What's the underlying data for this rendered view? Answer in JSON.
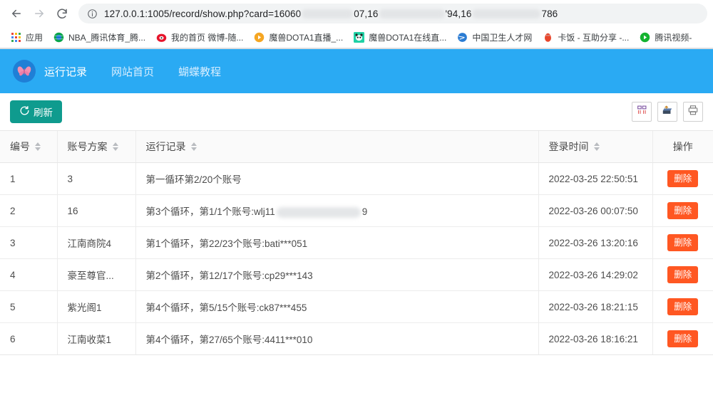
{
  "browser": {
    "back_icon": "back-arrow-icon",
    "forward_icon": "forward-arrow-icon",
    "reload_icon": "reload-icon",
    "info_icon": "site-info-icon",
    "url_prefix": "127.0.0.1:1005/record/show.php?card=16060",
    "url_part2": "07,16",
    "url_part3": "'94,16",
    "url_part4": "786",
    "bookmarks": [
      {
        "label": "应用",
        "icon": "apps-grid-icon",
        "color": "#4285f4"
      },
      {
        "label": "NBA_腾讯体育_腾...",
        "icon": "tencent-sports-icon",
        "color": "#0aa54a"
      },
      {
        "label": "我的首页 微博-随...",
        "icon": "weibo-icon",
        "color": "#e6162d"
      },
      {
        "label": "魔兽DOTA1直播_...",
        "icon": "live-play-icon",
        "color": "#f5a623"
      },
      {
        "label": "魔兽DOTA1在线直...",
        "icon": "panda-tv-icon",
        "color": "#1fd1a5"
      },
      {
        "label": "中国卫生人才网",
        "icon": "globe-icon",
        "color": "#2b7cd3"
      },
      {
        "label": "卡饭 - 互助分享 -...",
        "icon": "qq-penguin-icon",
        "color": "#e8462c"
      },
      {
        "label": "腾讯视频-",
        "icon": "tencent-video-icon",
        "color": "#14b330"
      }
    ]
  },
  "site": {
    "logo_icon": "butterfly-logo-icon",
    "nav": [
      {
        "label": "运行记录",
        "active": true
      },
      {
        "label": "网站首页",
        "active": false
      },
      {
        "label": "蝴蝶教程",
        "active": false
      }
    ]
  },
  "toolbar": {
    "refresh_label": "刷新",
    "refresh_icon": "refresh-icon",
    "columns_icon": "columns-toggle-icon",
    "export_icon": "export-icon",
    "print_icon": "print-icon",
    "refresh_color": "#0f9b8e"
  },
  "table": {
    "columns": [
      {
        "label": "编号",
        "sortable": true
      },
      {
        "label": "账号方案",
        "sortable": true
      },
      {
        "label": "运行记录",
        "sortable": true
      },
      {
        "label": "登录时间",
        "sortable": true
      },
      {
        "label": "操作",
        "sortable": false
      }
    ],
    "delete_label": "删除",
    "delete_color": "#ff5722",
    "rows": [
      {
        "id": "1",
        "plan": "3",
        "record_pre": "第一循环第2/20个账号",
        "record_post": "",
        "redacted": false,
        "time": "2022-03-25 22:50:51"
      },
      {
        "id": "2",
        "plan": "16",
        "record_pre": "第3个循环，第1/1个账号:wlj11",
        "record_post": "9",
        "redacted": true,
        "time": "2022-03-26 00:07:50"
      },
      {
        "id": "3",
        "plan": "江南商院4",
        "record_pre": "第1个循环，第22/23个账号:bati***051",
        "record_post": "",
        "redacted": false,
        "time": "2022-03-26 13:20:16"
      },
      {
        "id": "4",
        "plan": "豪至尊官...",
        "record_pre": "第2个循环，第12/17个账号:cp29***143",
        "record_post": "",
        "redacted": false,
        "time": "2022-03-26 14:29:02"
      },
      {
        "id": "5",
        "plan": "紫光阁1",
        "record_pre": "第4个循环，第5/15个账号:ck87***455",
        "record_post": "",
        "redacted": false,
        "time": "2022-03-26 18:21:15"
      },
      {
        "id": "6",
        "plan": "江南收菜1",
        "record_pre": "第4个循环，第27/65个账号:4411***010",
        "record_post": "",
        "redacted": false,
        "time": "2022-03-26 18:16:21"
      }
    ]
  }
}
